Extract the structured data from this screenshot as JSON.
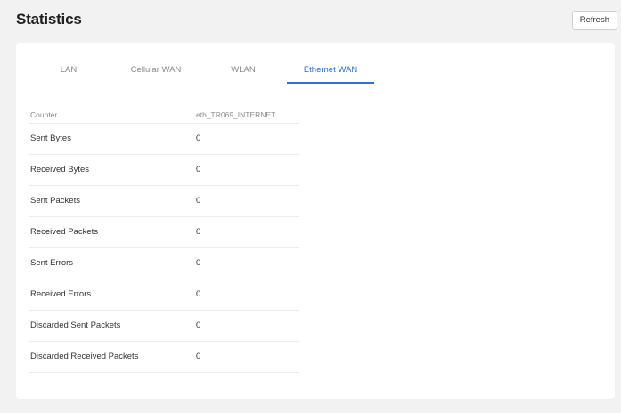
{
  "header": {
    "title": "Statistics",
    "refresh_label": "Refresh"
  },
  "tabs": [
    {
      "label": "LAN",
      "active": false
    },
    {
      "label": "Cellular WAN",
      "active": false
    },
    {
      "label": "WLAN",
      "active": false
    },
    {
      "label": "Ethernet WAN",
      "active": true
    }
  ],
  "table": {
    "headers": {
      "counter": "Counter",
      "interface": "eth_TR069_INTERNET"
    },
    "rows": [
      {
        "counter": "Sent Bytes",
        "value": "0"
      },
      {
        "counter": "Received Bytes",
        "value": "0"
      },
      {
        "counter": "Sent Packets",
        "value": "0"
      },
      {
        "counter": "Received Packets",
        "value": "0"
      },
      {
        "counter": "Sent Errors",
        "value": "0"
      },
      {
        "counter": "Received Errors",
        "value": "0"
      },
      {
        "counter": "Discarded Sent Packets",
        "value": "0"
      },
      {
        "counter": "Discarded Received Packets",
        "value": "0"
      }
    ]
  },
  "colors": {
    "accent": "#2f6fd6",
    "background": "#f2f2f3",
    "card": "#ffffff"
  }
}
